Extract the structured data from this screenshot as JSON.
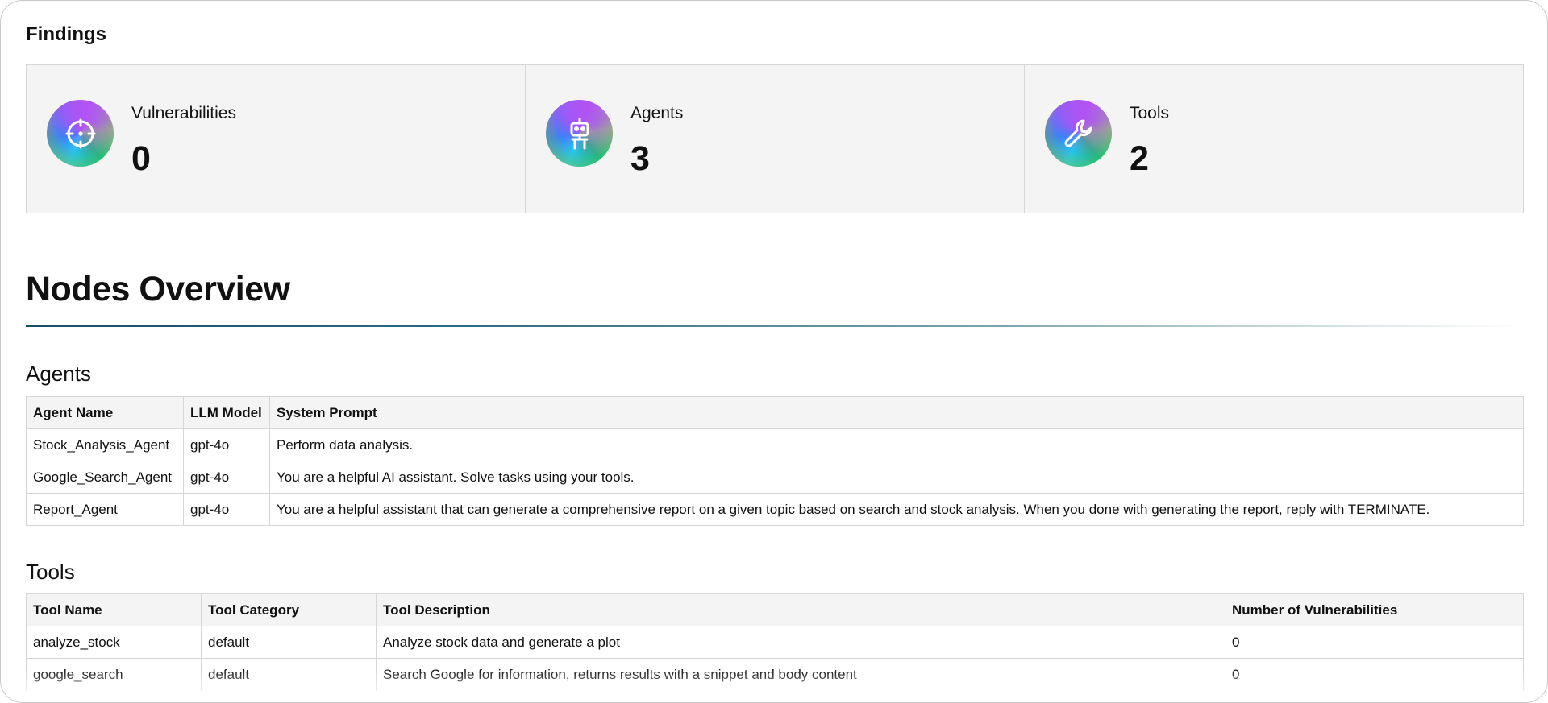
{
  "findings": {
    "title": "Findings",
    "cards": [
      {
        "label": "Vulnerabilities",
        "value": "0",
        "icon": "crosshair-icon"
      },
      {
        "label": "Agents",
        "value": "3",
        "icon": "robot-icon"
      },
      {
        "label": "Tools",
        "value": "2",
        "icon": "wrench-icon"
      }
    ]
  },
  "nodes_overview": {
    "title": "Nodes Overview",
    "agents": {
      "title": "Agents",
      "headers": [
        "Agent Name",
        "LLM Model",
        "System Prompt"
      ],
      "rows": [
        [
          "Stock_Analysis_Agent",
          "gpt-4o",
          "Perform data analysis."
        ],
        [
          "Google_Search_Agent",
          "gpt-4o",
          "You are a helpful AI assistant. Solve tasks using your tools."
        ],
        [
          "Report_Agent",
          "gpt-4o",
          "You are a helpful assistant that can generate a comprehensive report on a given topic based on search and stock analysis. When you done with generating the report, reply with TERMINATE."
        ]
      ]
    },
    "tools": {
      "title": "Tools",
      "headers": [
        "Tool Name",
        "Tool Category",
        "Tool Description",
        "Number of Vulnerabilities"
      ],
      "rows": [
        [
          "analyze_stock",
          "default",
          "Analyze stock data and generate a plot",
          "0"
        ],
        [
          "google_search",
          "default",
          "Search Google for information, returns results with a snippet and body content",
          "0"
        ]
      ]
    }
  }
}
